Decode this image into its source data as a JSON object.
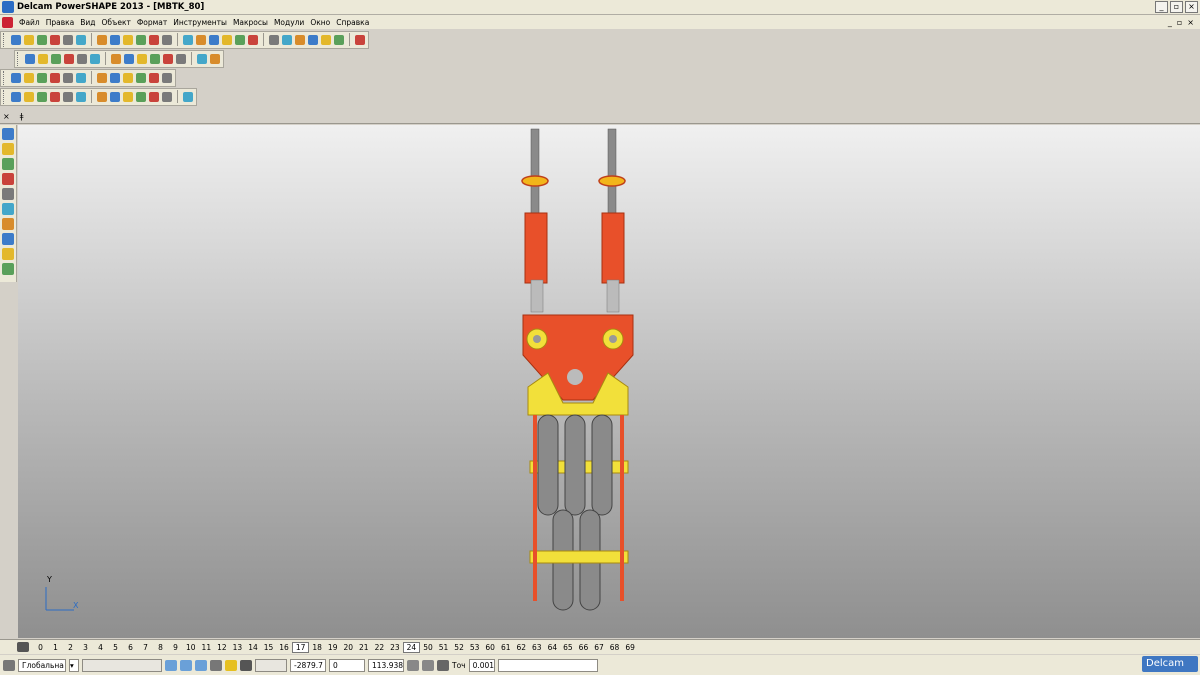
{
  "window": {
    "title": "Delcam PowerSHAPE 2013 - [MBTK_80]"
  },
  "menu": [
    "Файл",
    "Правка",
    "Вид",
    "Объект",
    "Формат",
    "Инструменты",
    "Макросы",
    "Модули",
    "Окно",
    "Справка"
  ],
  "toolbars": {
    "row1_icons": [
      "spin-icon",
      "new-file-icon",
      "open-icon",
      "open-folder-icon",
      "save-icon",
      "save-as-icon",
      "print-icon",
      "cut-icon",
      "copy-icon",
      "paste-icon",
      "delete-icon",
      "clear-icon",
      "undo-icon",
      "redo-icon",
      "sketch-icon",
      "measure-icon",
      "workplane-icon",
      "select-icon",
      "circle-icon",
      "curve-icon",
      "text-icon",
      "surface-icon",
      "solid-icon",
      "solid2-icon",
      "tools-icon"
    ],
    "row2_icons": [
      "view-top-icon",
      "view-front-icon",
      "view-side-icon",
      "view-iso-icon",
      "view-iso2-icon",
      "rotate-icon",
      "zoom-icon",
      "zoom-in-icon",
      "zoom-out-icon",
      "globe-icon",
      "shade-icon",
      "shade2-icon",
      "lamp-icon",
      "hand-icon"
    ],
    "row3_icons": [
      "file-icon",
      "doc-icon",
      "surface-blue-icon",
      "sphere-icon",
      "red-sphere-icon",
      "cone-icon",
      "green-cone-icon",
      "box-icon",
      "frame-icon",
      "blue-box-icon",
      "multi-icon",
      "star-icon"
    ],
    "row4_icons": [
      "wire-icon",
      "axis-icon",
      "solid-blue-icon",
      "solid-green-icon",
      "ring-icon",
      "block-icon",
      "gear-icon",
      "chain-icon",
      "grid-icon",
      "assembly-icon",
      "assembly2-icon",
      "blend-icon",
      "pyramid-icon"
    ]
  },
  "left_tools": [
    "cursor-icon",
    "select-window-icon",
    "line-icon",
    "polyline-icon",
    "rectangle-icon",
    "circle-tool-icon",
    "solid-tool-icon",
    "dimension-icon",
    "curve-tool-icon",
    "ruler-icon"
  ],
  "levels": {
    "items": [
      "0",
      "1",
      "2",
      "3",
      "4",
      "5",
      "6",
      "7",
      "8",
      "9",
      "10",
      "11",
      "12",
      "13",
      "14",
      "15",
      "16",
      "17",
      "18",
      "19",
      "20",
      "21",
      "22",
      "23",
      "24",
      "50",
      "51",
      "52",
      "53",
      "60",
      "61",
      "62",
      "63",
      "64",
      "65",
      "66",
      "67",
      "68",
      "69"
    ],
    "active": [
      "17",
      "24"
    ]
  },
  "status": {
    "workplane": "Глобальна",
    "coord_x": "-2879.7",
    "coord_y": "0",
    "coord_z": "113.938",
    "tolerance_label": "Точ",
    "tolerance_value": "0.001",
    "brand": "Delcam"
  },
  "axis": {
    "y": "Y",
    "x": "X"
  },
  "colors": {
    "body_red": "#e8502a",
    "frame_yellow": "#f2e03a",
    "steel": "#8a8a8a"
  }
}
